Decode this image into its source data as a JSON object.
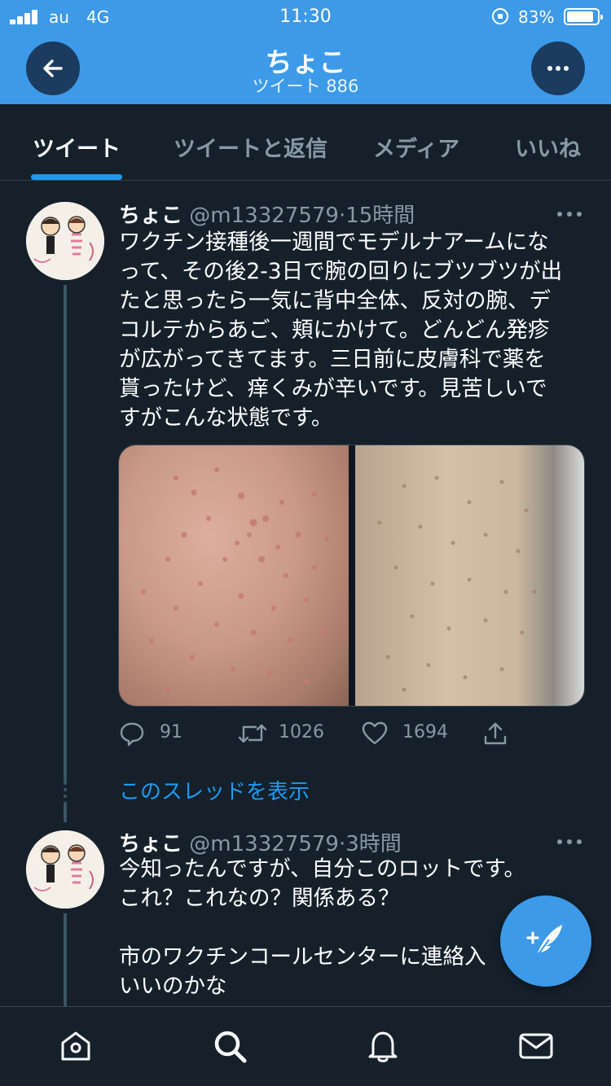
{
  "status_bar": {
    "carrier": "au",
    "network": "4G",
    "time": "11:30",
    "battery": "83%"
  },
  "header": {
    "title": "ちょこ",
    "subtitle": "ツイート 886"
  },
  "tabs": [
    {
      "label": "ツイート",
      "active": true
    },
    {
      "label": "ツイートと返信",
      "active": false
    },
    {
      "label": "メディア",
      "active": false
    },
    {
      "label": "いいね",
      "active": false
    }
  ],
  "tweets": [
    {
      "name": "ちょこ",
      "handle": "@m13327579",
      "dot": "·",
      "time": "15時間",
      "text": "ワクチン接種後一週間でモデルナアームにな\nって、その後2-3日で腕の回りにブツブツが出\nたと思ったら一気に背中全体、反対の腕、デ\nコルテからあご、頬にかけて。どんどん発疹\nが広がってきてます。三日前に皮膚科で薬を\n貰ったけど、痒くみが辛いです。見苦しいで\nすがこんな状態です。",
      "replies": "91",
      "retweets": "1026",
      "likes": "1694"
    },
    {
      "name": "ちょこ",
      "handle": "@m13327579",
      "dot": "·",
      "time": "3時間",
      "text": "今知ったんですが、自分このロットです。\nこれ？これなの？関係ある？\n\n市のワクチンコールセンターに連絡入\nいいのかな"
    }
  ],
  "show_thread": "このスレッドを表示",
  "icons": {
    "back": "arrow-left-icon",
    "more": "more-horizontal-icon",
    "reply": "reply-icon",
    "retweet": "retweet-icon",
    "like": "heart-icon",
    "share": "share-icon",
    "compose": "compose-feather-icon",
    "home": "home-icon",
    "search": "search-icon",
    "notifications": "bell-icon",
    "messages": "mail-icon"
  },
  "colors": {
    "header_bg": "#3d9ae8",
    "background": "#15202b",
    "accent": "#1d9bf0",
    "muted": "#8899a6"
  }
}
